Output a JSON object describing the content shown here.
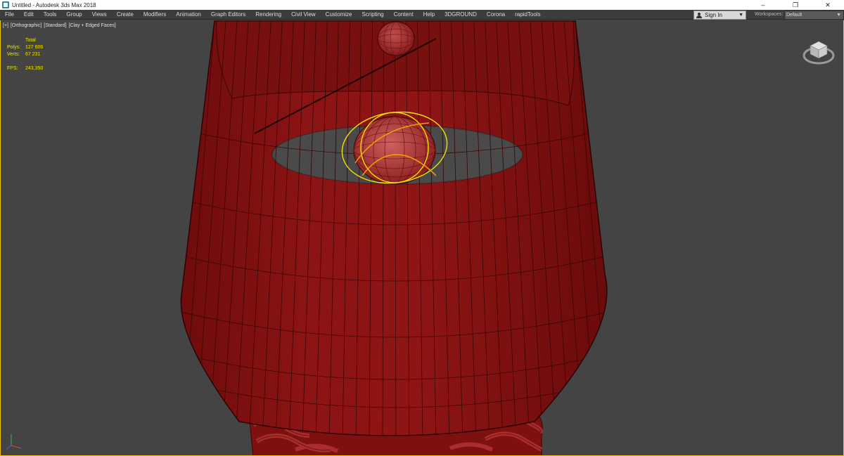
{
  "window": {
    "title": "Untitled - Autodesk 3ds Max 2018",
    "controls": {
      "minimize": "–",
      "maximize": "❐",
      "close": "✕"
    }
  },
  "menu": {
    "items": [
      "File",
      "Edit",
      "Tools",
      "Group",
      "Views",
      "Create",
      "Modifiers",
      "Animation",
      "Graph Editors",
      "Rendering",
      "Civil View",
      "Customize",
      "Scripting",
      "Content",
      "Help",
      "3DGROUND",
      "Corona",
      "rapidTools"
    ],
    "signin_label": "Sign In",
    "workspaces_label": "Workspaces:",
    "workspaces_value": "Default"
  },
  "viewport": {
    "label_parts": [
      "[+]",
      "[Orthographic]",
      "[Standard]",
      "[Clay + Edged Faces]"
    ],
    "stats": {
      "total_label": "Total",
      "polys_label": "Polys:",
      "polys_value": "127 606",
      "verts_label": "Verts:",
      "verts_value": "67 231",
      "fps_label": "FPS:",
      "fps_value": "243,350"
    }
  },
  "colors": {
    "viewport_bg": "#444444",
    "mesh_red": "#8a1212",
    "wire": "#3a0505",
    "selection_yellow": "#f0e400",
    "stats_yellow": "#f0e400",
    "active_border": "#f2c200"
  },
  "icons": {
    "app": "3dsmax-app-icon",
    "viewcube": "viewcube-icon",
    "axis": "axis-tripod-icon",
    "user": "user-icon"
  }
}
